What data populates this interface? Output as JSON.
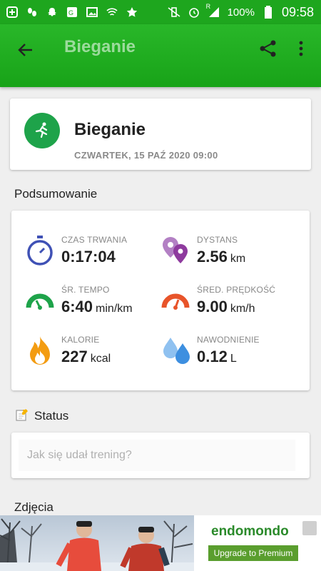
{
  "status_bar": {
    "battery": "100%",
    "time": "09:58",
    "signal_label": "R"
  },
  "app_bar": {
    "title": "Bieganie"
  },
  "workout": {
    "title": "Bieganie",
    "date": "CZWARTEK, 15 PAŹ 2020 09:00"
  },
  "summary": {
    "section_title": "Podsumowanie",
    "stats": [
      {
        "label": "CZAS TRWANIA",
        "value": "0:17:04",
        "unit": "",
        "icon": "stopwatch-icon",
        "color": "#3f51b5"
      },
      {
        "label": "DYSTANS",
        "value": "2.56",
        "unit": "km",
        "icon": "map-pins-icon",
        "color": "#8e3a9e"
      },
      {
        "label": "ŚR. TEMPO",
        "value": "6:40",
        "unit": "min/km",
        "icon": "pace-gauge-icon",
        "color": "#1ea34a"
      },
      {
        "label": "ŚRED. PRĘDKOŚĆ",
        "value": "9.00",
        "unit": "km/h",
        "icon": "speed-gauge-icon",
        "color": "#e8542a"
      },
      {
        "label": "KALORIE",
        "value": "227",
        "unit": "kcal",
        "icon": "flame-icon",
        "color": "#f39c12"
      },
      {
        "label": "NAWODNIENIE",
        "value": "0.12",
        "unit": "L",
        "icon": "water-drops-icon",
        "color": "#3d8fe0"
      }
    ]
  },
  "status": {
    "section_title": "Status",
    "placeholder": "Jak się udał trening?"
  },
  "photos": {
    "section_title": "Zdjęcia"
  },
  "ad": {
    "brand": "endomondo",
    "cta": "Upgrade to Premium"
  },
  "colors": {
    "primary": "#1ea61e",
    "accent": "#1ea34a"
  }
}
